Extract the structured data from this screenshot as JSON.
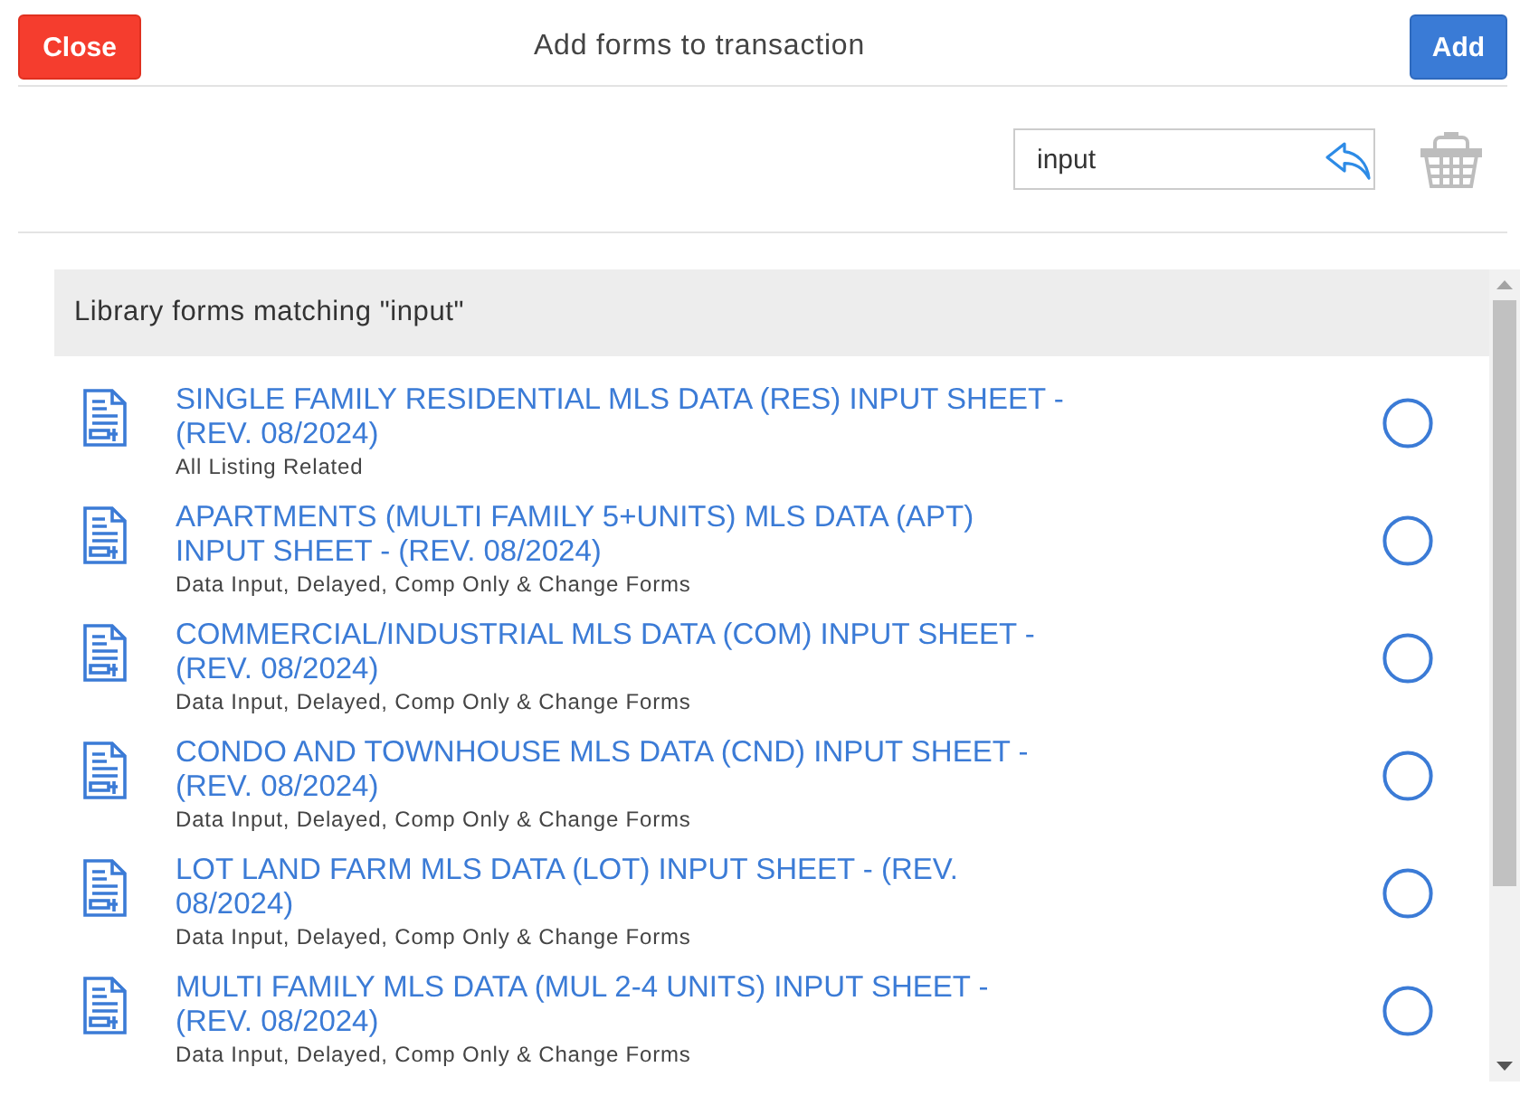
{
  "header": {
    "close_label": "Close",
    "title": "Add forms to transaction",
    "add_label": "Add"
  },
  "search": {
    "value": "input"
  },
  "results": {
    "heading": "Library forms matching \"input\"",
    "forms": [
      {
        "title": "SINGLE FAMILY RESIDENTIAL MLS DATA (RES) INPUT SHEET - (REV. 08/2024)",
        "category": "All Listing Related",
        "selected": false
      },
      {
        "title": "APARTMENTS (MULTI FAMILY 5+UNITS) MLS DATA (APT) INPUT SHEET - (REV. 08/2024)",
        "category": "Data Input, Delayed, Comp Only & Change Forms",
        "selected": false
      },
      {
        "title": "COMMERCIAL/INDUSTRIAL MLS DATA (COM) INPUT SHEET - (REV. 08/2024)",
        "category": "Data Input, Delayed, Comp Only & Change Forms",
        "selected": false
      },
      {
        "title": "CONDO AND TOWNHOUSE MLS DATA (CND) INPUT SHEET - (REV. 08/2024)",
        "category": "Data Input, Delayed, Comp Only & Change Forms",
        "selected": false
      },
      {
        "title": "LOT LAND FARM MLS DATA (LOT) INPUT SHEET - (REV. 08/2024)",
        "category": "Data Input, Delayed, Comp Only & Change Forms",
        "selected": false
      },
      {
        "title": "MULTI FAMILY MLS DATA (MUL 2-4 UNITS) INPUT SHEET - (REV. 08/2024)",
        "category": "Data Input, Delayed, Comp Only & Change Forms",
        "selected": false
      }
    ]
  }
}
